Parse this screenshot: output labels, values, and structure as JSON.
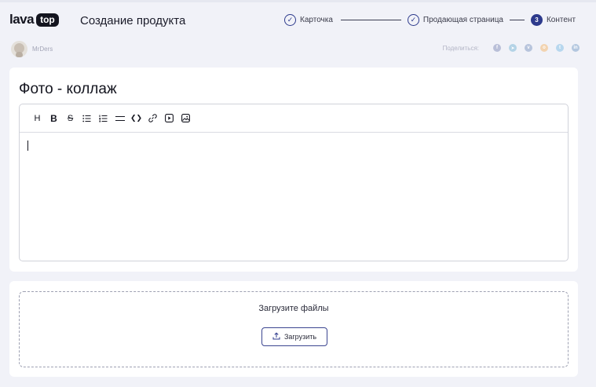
{
  "header": {
    "logo_left": "lava",
    "logo_right": "top",
    "title": "Создание продукта"
  },
  "steps": [
    {
      "label": "Карточка",
      "state": "done",
      "marker": "✓"
    },
    {
      "label": "Продающая страница",
      "state": "done",
      "marker": "✓"
    },
    {
      "label": "Контент",
      "state": "current",
      "marker": "3"
    }
  ],
  "author": {
    "name": "MrDers"
  },
  "share": {
    "label": "Поделиться:",
    "icons": [
      {
        "name": "facebook-icon",
        "color": "#b9bfd8"
      },
      {
        "name": "telegram-icon",
        "color": "#b4d3e6"
      },
      {
        "name": "vk-icon",
        "color": "#b7c4dc"
      },
      {
        "name": "odnoklassniki-icon",
        "color": "#f2d3b0"
      },
      {
        "name": "twitter-icon",
        "color": "#b7d7ee"
      },
      {
        "name": "linkedin-icon",
        "color": "#b3c7df"
      }
    ]
  },
  "editor_card": {
    "title": "Фото - коллаж",
    "toolbar": [
      {
        "name": "heading-icon",
        "glyph": "H"
      },
      {
        "name": "bold-icon",
        "glyph": "B"
      },
      {
        "name": "strikethrough-icon",
        "glyph": "S"
      },
      {
        "name": "bullet-list-icon",
        "glyph": "☰"
      },
      {
        "name": "ordered-list-icon",
        "glyph": "☷"
      },
      {
        "name": "horizontal-rule-icon",
        "glyph": "☰"
      },
      {
        "name": "code-icon",
        "glyph": "⟨⟩"
      },
      {
        "name": "link-icon",
        "glyph": "🔗"
      },
      {
        "name": "video-icon",
        "glyph": "▶"
      },
      {
        "name": "image-icon",
        "glyph": "▣"
      }
    ],
    "content": ""
  },
  "upload_card": {
    "title": "Загрузите файлы",
    "button_label": "Загрузить"
  },
  "colors": {
    "accent": "#2d3a8c",
    "background": "#f1f2f8"
  }
}
